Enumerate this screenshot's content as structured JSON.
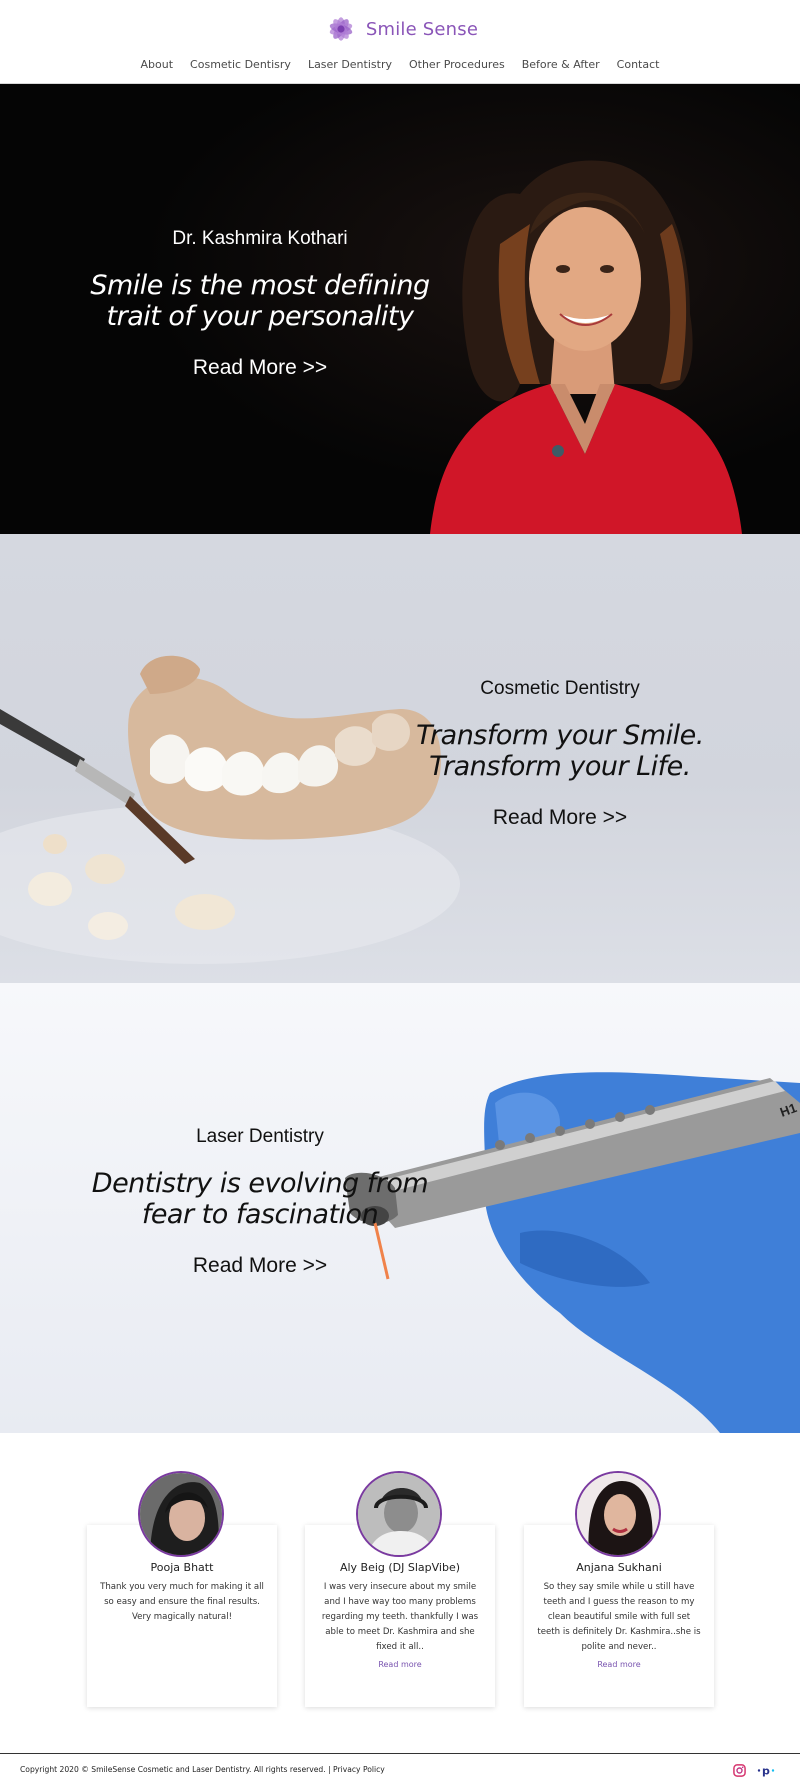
{
  "brand": {
    "name": "Smile Sense",
    "logo_color": "#8a55b8"
  },
  "nav": {
    "items": [
      "About",
      "Cosmetic Dentisry",
      "Laser Dentistry",
      "Other Procedures",
      "Before & After",
      "Contact"
    ]
  },
  "hero": [
    {
      "subtitle": "Dr. Kashmira Kothari",
      "quote_line1": "Smile is the most defining",
      "quote_line2": "trait of your personality",
      "cta": "Read More >>"
    },
    {
      "subtitle": "Cosmetic Dentistry",
      "quote_line1": "Transform your Smile.",
      "quote_line2": "Transform your Life.",
      "cta": "Read More >>"
    },
    {
      "subtitle": "Laser Dentistry",
      "quote_line1": "Dentistry is evolving from",
      "quote_line2": "fear to fascination",
      "cta": "Read More >>"
    }
  ],
  "testimonials": [
    {
      "name": "Pooja Bhatt",
      "text": "Thank you very much for making it all so easy and ensure the final results. Very magically natural!",
      "more": ""
    },
    {
      "name": "Aly Beig (DJ SlapVibe)",
      "text": "I was very insecure about my smile and I have way too many problems regarding my teeth. thankfully I was able to meet Dr. Kashmira and she fixed it all..",
      "more": "Read more"
    },
    {
      "name": "Anjana Sukhani",
      "text": "So they say smile while u still have teeth and I guess the reason to my clean beautiful smile with full set teeth is definitely Dr. Kashmira..she is polite and never..",
      "more": "Read more"
    }
  ],
  "footer": {
    "copyright": "Copyright 2020 © SmileSense Cosmetic and Laser Dentistry. All rights reserved. | Privacy Policy",
    "social": [
      "instagram-icon",
      "practo-icon"
    ]
  }
}
